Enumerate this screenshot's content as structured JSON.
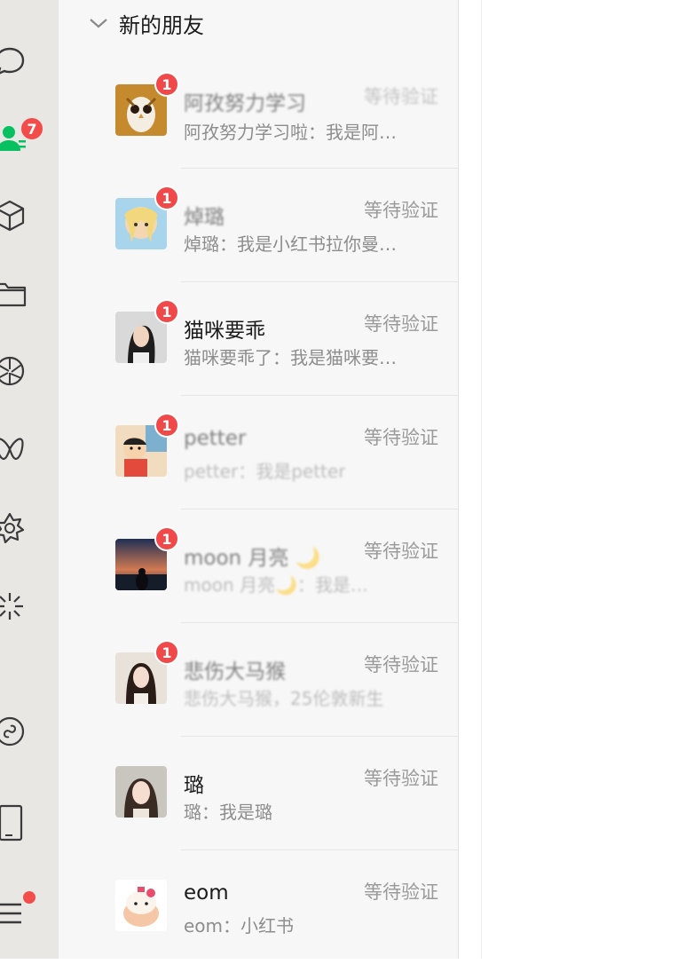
{
  "group_title": "新的朋友",
  "sidebar": {
    "contacts_badge": "7"
  },
  "requests": [
    {
      "name": "阿孜努力学习",
      "status": "等待验证",
      "preview": "阿孜努力学习啦：我是阿…",
      "badge": "1"
    },
    {
      "name": "焯璐",
      "status": "等待验证",
      "preview": "焯璐：我是小红书拉你曼…",
      "badge": "1"
    },
    {
      "name": "猫咪要乖",
      "status": "等待验证",
      "preview": "猫咪要乖了：我是猫咪要…",
      "badge": "1"
    },
    {
      "name": "petter",
      "status": "等待验证",
      "preview": "petter：我是petter",
      "badge": "1"
    },
    {
      "name": "moon 月亮 🌙",
      "status": "等待验证",
      "preview": "moon 月亮🌙：我是…",
      "badge": "1"
    },
    {
      "name": "悲伤大马猴",
      "status": "等待验证",
      "preview": "悲伤大马猴，25伦敦新生",
      "badge": "1"
    },
    {
      "name": "璐",
      "status": "等待验证",
      "preview": "璐：我是璐",
      "badge": ""
    },
    {
      "name": "eom",
      "status": "等待验证",
      "preview": "eom：小红书",
      "badge": ""
    }
  ]
}
